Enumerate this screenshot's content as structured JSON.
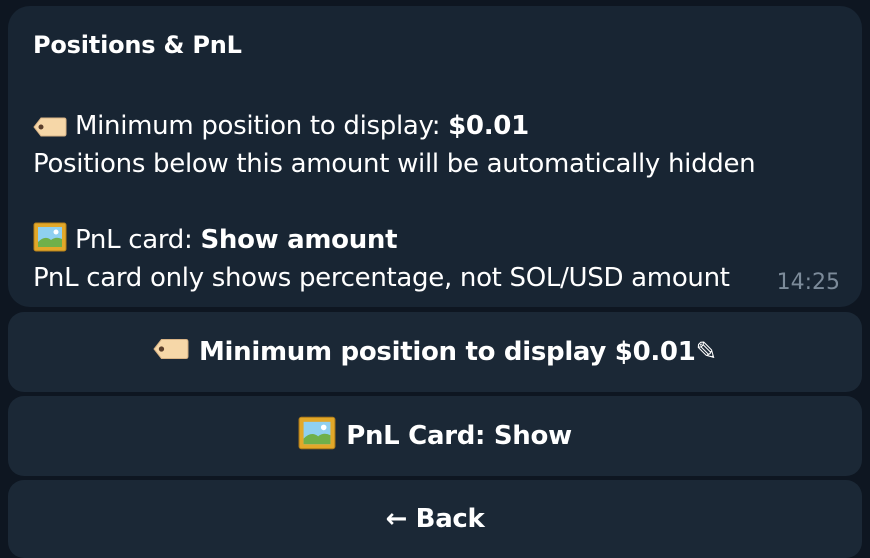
{
  "message": {
    "title": "Positions & PnL",
    "min_label": "Minimum position to display: ",
    "min_value": "$0.01",
    "min_note": "Positions below this amount will be automatically hidden",
    "pnl_label": "PnL card: ",
    "pnl_value": "Show amount",
    "pnl_note": "PnL card only shows percentage, not SOL/USD amount",
    "time": "14:25",
    "icons": {
      "tag": "label-tag-icon",
      "picture": "framed-picture-icon"
    }
  },
  "keyboard": {
    "min_button": "Minimum position to display $0.01✎",
    "pnl_button": "PnL Card: Show",
    "back_button": "← Back"
  },
  "colors": {
    "background": "#0e1621",
    "bubble": "#182533",
    "button": "#1b2836",
    "timestamp": "#7c8b9a"
  }
}
